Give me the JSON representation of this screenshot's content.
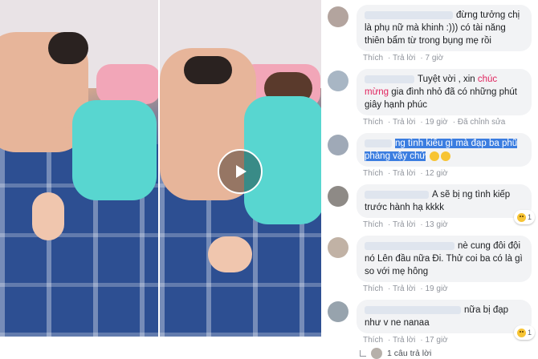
{
  "video": {
    "play_icon": "play-icon"
  },
  "comments": [
    {
      "text_a": "đừng tưởng chị là phụ nữ mà khinh :))) có tài năng thiên bẩm từ trong bụng mẹ rồi",
      "like": "Thích",
      "reply": "Trả lời",
      "time": "7 giờ"
    },
    {
      "text_a": "Tuyệt vời , xin ",
      "text_hl": "chúc mừng",
      "text_b": " gia đình nhỏ đã có những phút giây hạnh phúc",
      "like": "Thích",
      "reply": "Trả lời",
      "time": "19 giờ",
      "edited": "Đã chỉnh sửa"
    },
    {
      "text_sel": "ng tình kiểu gì mà đạp ba phũ phàng vậy chứ",
      "like": "Thích",
      "reply": "Trả lời",
      "time": "12 giờ"
    },
    {
      "text_a": "A sẽ bị ng tình kiếp trước hành hạ kkkk",
      "like": "Thích",
      "reply": "Trả lời",
      "time": "13 giờ",
      "reaction_count": "1"
    },
    {
      "text_a": "nè cung đôi đội nó Lên đầu nữa Đi. Thử coi ba có là gì so với mẹ hông",
      "like": "Thích",
      "reply": "Trả lời",
      "time": "19 giờ"
    },
    {
      "text_a": "nữa bị đạp như v ne nanaa",
      "like": "Thích",
      "reply": "Trả lời",
      "time": "17 giờ",
      "reaction_count": "1"
    }
  ],
  "replies": {
    "label": "1 câu trả lời"
  }
}
